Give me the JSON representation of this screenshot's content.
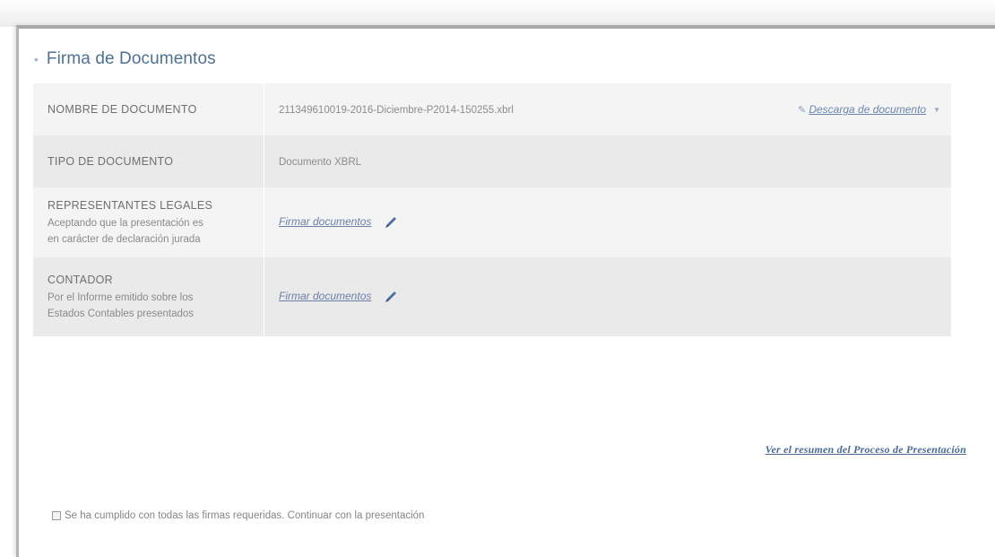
{
  "section": {
    "title": "Firma de Documentos"
  },
  "rows": [
    {
      "label": "NOMBRE DE DOCUMENTO",
      "value": "211349610019-2016-Diciembre-P2014-150255.xbrl",
      "download_label": "Descarga de documento"
    },
    {
      "label": "TIPO DE DOCUMENTO",
      "value": "Documento XBRL"
    },
    {
      "label": "REPRESENTANTES LEGALES",
      "sub_lines": [
        "Aceptando que la presentación es",
        "en carácter de declaración jurada"
      ],
      "action_label": "Firmar documentos"
    },
    {
      "label": "CONTADOR",
      "sub_lines": [
        "Por el Informe emitido sobre los",
        "Estados Contables presentados"
      ],
      "action_label": "Firmar documentos"
    }
  ],
  "summary_link": "Ver el resumen del Proceso de Presentación",
  "confirm": {
    "label": "Se ha cumplido con todas las firmas requeridas. Continuar con la presentación",
    "checked": false
  },
  "icons": {
    "title_bullet": "bullet-icon",
    "download": "paperclip-icon",
    "dropdown": "caret-down-icon",
    "sign": "pen-icon"
  },
  "colors": {
    "title": "#4e7194",
    "link": "#6a86ad",
    "row_light": "#f4f4f4",
    "row_dark": "#eaeaea"
  }
}
